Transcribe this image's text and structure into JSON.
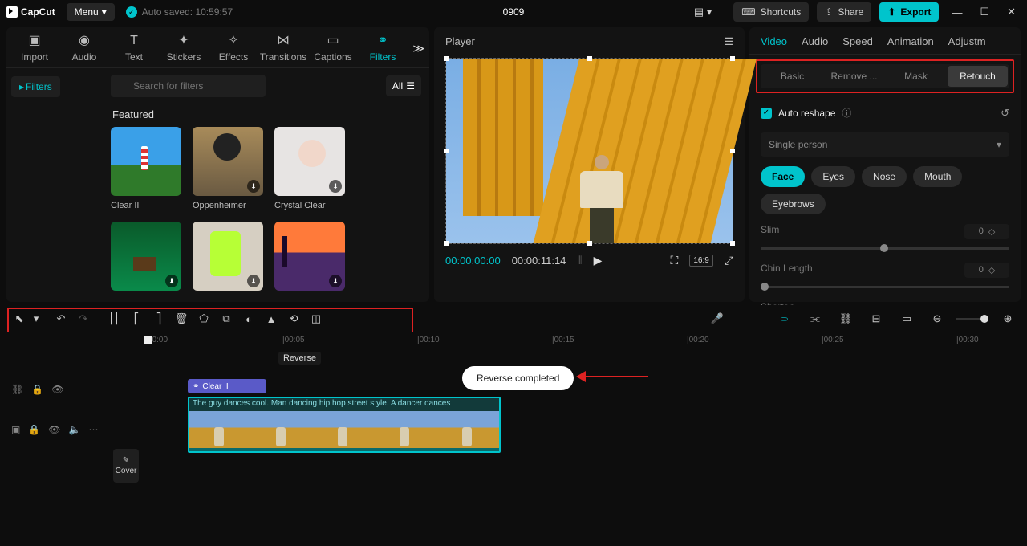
{
  "header": {
    "app_name": "CapCut",
    "menu_label": "Menu",
    "autosave": "Auto saved: 10:59:57",
    "project_title": "0909",
    "shortcuts": "Shortcuts",
    "share": "Share",
    "export": "Export"
  },
  "media_tabs": {
    "import": "Import",
    "audio": "Audio",
    "text": "Text",
    "stickers": "Stickers",
    "effects": "Effects",
    "transitions": "Transitions",
    "captions": "Captions",
    "filters": "Filters"
  },
  "filters_panel": {
    "side_label": "Filters",
    "search_placeholder": "Search for filters",
    "all": "All",
    "featured": "Featured",
    "items": [
      {
        "label": "Clear II"
      },
      {
        "label": "Oppenheimer"
      },
      {
        "label": "Crystal Clear"
      },
      {
        "label": ""
      },
      {
        "label": ""
      },
      {
        "label": ""
      }
    ]
  },
  "player": {
    "title": "Player",
    "current": "00:00:00:00",
    "duration": "00:00:11:14",
    "ratio": "16:9"
  },
  "inspector": {
    "tabs": {
      "video": "Video",
      "audio": "Audio",
      "speed": "Speed",
      "animation": "Animation",
      "adjust": "Adjustm"
    },
    "sub": {
      "basic": "Basic",
      "remove": "Remove ...",
      "mask": "Mask",
      "retouch": "Retouch"
    },
    "auto_reshape": "Auto reshape",
    "mode": "Single person",
    "pills": {
      "face": "Face",
      "eyes": "Eyes",
      "nose": "Nose",
      "mouth": "Mouth",
      "eyebrows": "Eyebrows"
    },
    "sliders": {
      "slim": "Slim",
      "chin": "Chin Length",
      "shorten": "Shorten"
    },
    "val_zero": "0"
  },
  "toolbar": {
    "tooltip": "Reverse",
    "cover": "Cover"
  },
  "ruler": [
    "00:00",
    "|00:05",
    "|00:10",
    "|00:15",
    "|00:20",
    "|00:25",
    "|00:30"
  ],
  "toast": "Reverse completed",
  "timeline": {
    "filter_clip": "Clear II",
    "clip_title": "The guy dances cool. Man dancing hip hop street style. A dancer dances"
  }
}
